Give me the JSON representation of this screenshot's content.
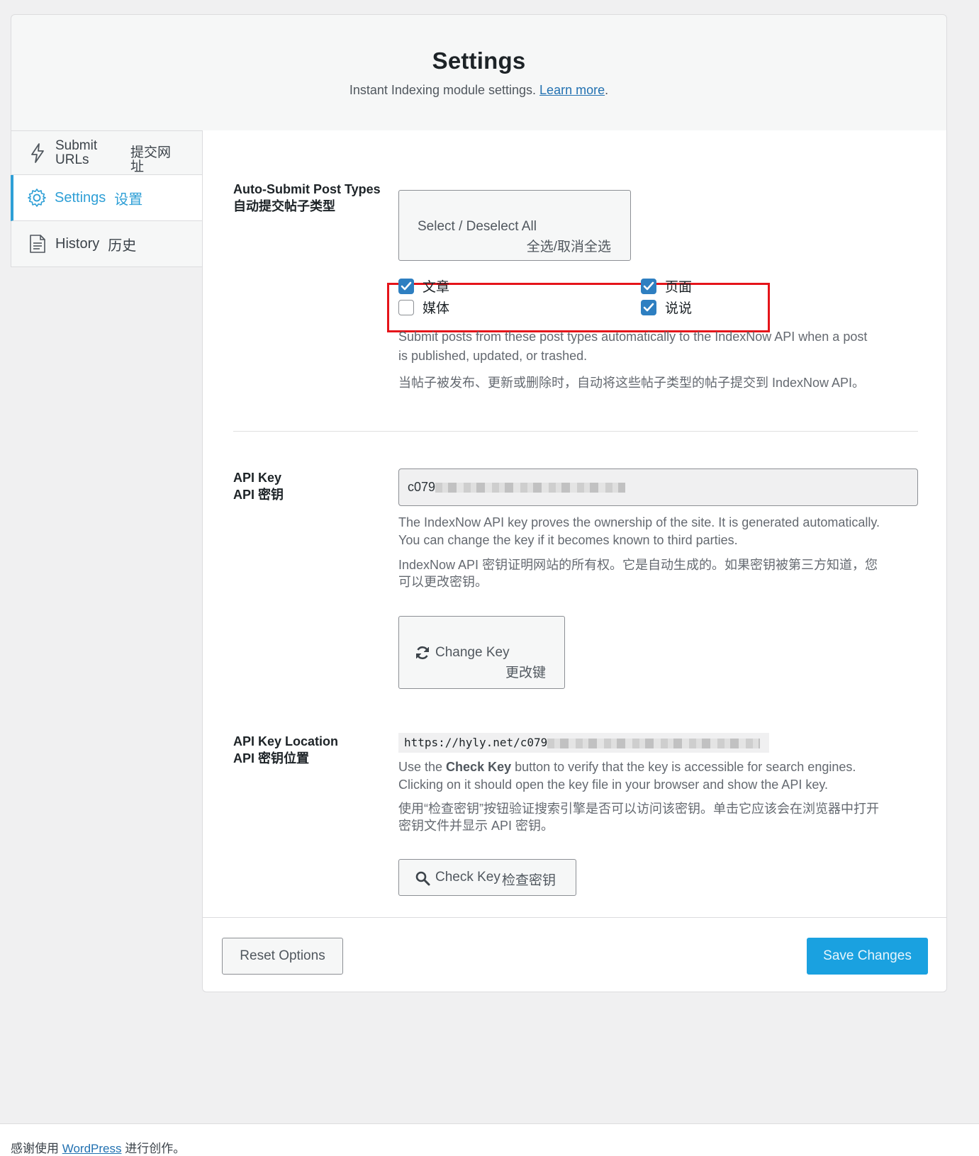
{
  "header": {
    "title": "Settings",
    "subtitle": "Instant Indexing module settings.",
    "learn_more": "Learn more",
    "period": "."
  },
  "nav": {
    "submit": {
      "label_en_1": "Submit",
      "label_en_2": "URLs",
      "label_cn_1": "提交网",
      "label_cn_2": "址",
      "icon": "lightning-icon"
    },
    "settings": {
      "label_en": "Settings",
      "label_cn": "设置",
      "icon": "gear-icon"
    },
    "history": {
      "label_en": "History",
      "label_cn": "历史",
      "icon": "document-icon"
    }
  },
  "post_types": {
    "label_en": "Auto-Submit Post Types",
    "label_cn": "自动提交帖子类型",
    "select_all_en": "Select / Deselect All",
    "select_all_cn": "全选/取消全选",
    "items": [
      {
        "label": "文章",
        "checked": true
      },
      {
        "label": "页面",
        "checked": true
      },
      {
        "label": "媒体",
        "checked": false
      },
      {
        "label": "说说",
        "checked": true
      }
    ],
    "help_en_1": "Submit posts from these post types automatically to the IndexNow API when a post",
    "help_en_2": "is published, updated, or trashed.",
    "help_cn": "当帖子被发布、更新或删除时，自动将这些帖子类型的帖子提交到 IndexNow API。"
  },
  "api_key": {
    "label_en": "API Key",
    "label_cn": "API 密钥",
    "value_prefix": "c079",
    "help_en_1": "The IndexNow API key proves the ownership of the site. It is generated automatically.",
    "help_en_2": "You can change the key if it becomes known to third parties.",
    "help_cn_1": "IndexNow API 密钥证明网站的所有权。它是自动生成的。如果密钥被第三方知道，您",
    "help_cn_2": "可以更改密钥。",
    "change_en": "Change Key",
    "change_cn": "更改键"
  },
  "api_location": {
    "label_en": "API Key Location",
    "label_cn": "API 密钥位置",
    "url_prefix": "https://hyly.net/c079",
    "help_en_1a": "Use the ",
    "help_en_1b": "Check Key",
    "help_en_1c": " button to verify that the key is accessible for search engines.",
    "help_en_2": "Clicking on it should open the key file in your browser and show the API key.",
    "help_cn_1": "使用“检查密钥”按钮验证搜索引擎是否可以访问该密钥。单击它应该会在浏览器中打开",
    "help_cn_2": "密钥文件并显示 API 密钥。",
    "check_en": "Check Key",
    "check_cn": "检查密钥"
  },
  "actions": {
    "reset": "Reset Options",
    "save": "Save Changes"
  },
  "wp_footer": {
    "before": "感谢使用",
    "link": "WordPress",
    "after": "进行创作。"
  },
  "colors": {
    "accent": "#2e9fd6",
    "save_button": "#1aa1e0",
    "highlight": "#e5141a",
    "checkbox": "#2e7fc1"
  }
}
